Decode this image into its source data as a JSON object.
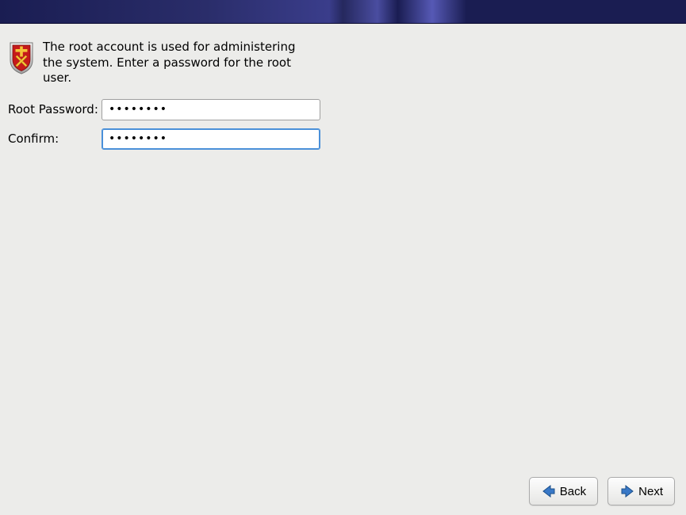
{
  "intro": {
    "description": "The root account is used for administering the system.  Enter a password for the root user."
  },
  "form": {
    "root_password_label": "Root Password:",
    "confirm_label": "Confirm:",
    "root_password_value": "••••••••",
    "confirm_value": "••••••••"
  },
  "buttons": {
    "back": "Back",
    "next": "Next"
  }
}
